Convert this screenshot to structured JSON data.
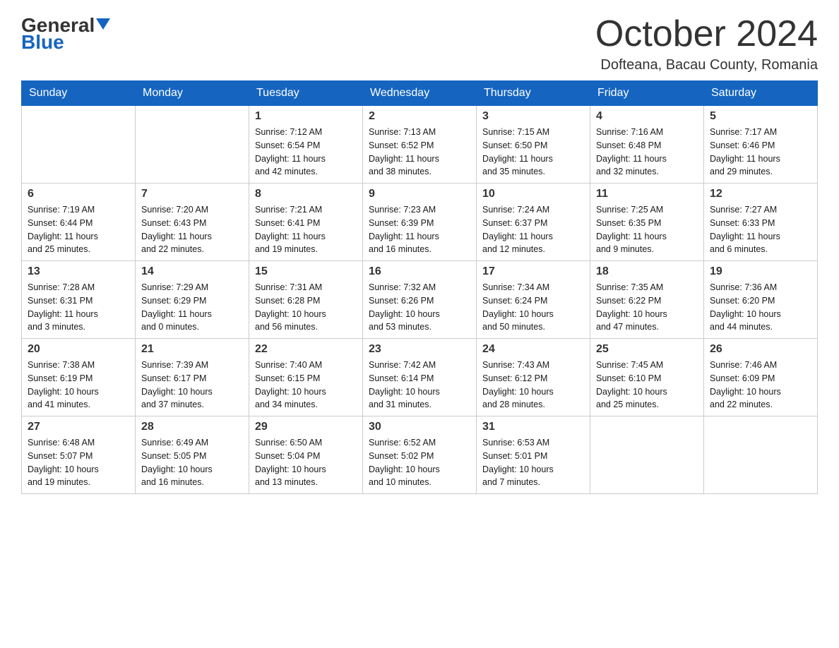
{
  "logo": {
    "general": "General",
    "blue": "Blue"
  },
  "title": {
    "month_year": "October 2024",
    "location": "Dofteana, Bacau County, Romania"
  },
  "days_of_week": [
    "Sunday",
    "Monday",
    "Tuesday",
    "Wednesday",
    "Thursday",
    "Friday",
    "Saturday"
  ],
  "weeks": [
    [
      {
        "day": "",
        "info": ""
      },
      {
        "day": "",
        "info": ""
      },
      {
        "day": "1",
        "info": "Sunrise: 7:12 AM\nSunset: 6:54 PM\nDaylight: 11 hours\nand 42 minutes."
      },
      {
        "day": "2",
        "info": "Sunrise: 7:13 AM\nSunset: 6:52 PM\nDaylight: 11 hours\nand 38 minutes."
      },
      {
        "day": "3",
        "info": "Sunrise: 7:15 AM\nSunset: 6:50 PM\nDaylight: 11 hours\nand 35 minutes."
      },
      {
        "day": "4",
        "info": "Sunrise: 7:16 AM\nSunset: 6:48 PM\nDaylight: 11 hours\nand 32 minutes."
      },
      {
        "day": "5",
        "info": "Sunrise: 7:17 AM\nSunset: 6:46 PM\nDaylight: 11 hours\nand 29 minutes."
      }
    ],
    [
      {
        "day": "6",
        "info": "Sunrise: 7:19 AM\nSunset: 6:44 PM\nDaylight: 11 hours\nand 25 minutes."
      },
      {
        "day": "7",
        "info": "Sunrise: 7:20 AM\nSunset: 6:43 PM\nDaylight: 11 hours\nand 22 minutes."
      },
      {
        "day": "8",
        "info": "Sunrise: 7:21 AM\nSunset: 6:41 PM\nDaylight: 11 hours\nand 19 minutes."
      },
      {
        "day": "9",
        "info": "Sunrise: 7:23 AM\nSunset: 6:39 PM\nDaylight: 11 hours\nand 16 minutes."
      },
      {
        "day": "10",
        "info": "Sunrise: 7:24 AM\nSunset: 6:37 PM\nDaylight: 11 hours\nand 12 minutes."
      },
      {
        "day": "11",
        "info": "Sunrise: 7:25 AM\nSunset: 6:35 PM\nDaylight: 11 hours\nand 9 minutes."
      },
      {
        "day": "12",
        "info": "Sunrise: 7:27 AM\nSunset: 6:33 PM\nDaylight: 11 hours\nand 6 minutes."
      }
    ],
    [
      {
        "day": "13",
        "info": "Sunrise: 7:28 AM\nSunset: 6:31 PM\nDaylight: 11 hours\nand 3 minutes."
      },
      {
        "day": "14",
        "info": "Sunrise: 7:29 AM\nSunset: 6:29 PM\nDaylight: 11 hours\nand 0 minutes."
      },
      {
        "day": "15",
        "info": "Sunrise: 7:31 AM\nSunset: 6:28 PM\nDaylight: 10 hours\nand 56 minutes."
      },
      {
        "day": "16",
        "info": "Sunrise: 7:32 AM\nSunset: 6:26 PM\nDaylight: 10 hours\nand 53 minutes."
      },
      {
        "day": "17",
        "info": "Sunrise: 7:34 AM\nSunset: 6:24 PM\nDaylight: 10 hours\nand 50 minutes."
      },
      {
        "day": "18",
        "info": "Sunrise: 7:35 AM\nSunset: 6:22 PM\nDaylight: 10 hours\nand 47 minutes."
      },
      {
        "day": "19",
        "info": "Sunrise: 7:36 AM\nSunset: 6:20 PM\nDaylight: 10 hours\nand 44 minutes."
      }
    ],
    [
      {
        "day": "20",
        "info": "Sunrise: 7:38 AM\nSunset: 6:19 PM\nDaylight: 10 hours\nand 41 minutes."
      },
      {
        "day": "21",
        "info": "Sunrise: 7:39 AM\nSunset: 6:17 PM\nDaylight: 10 hours\nand 37 minutes."
      },
      {
        "day": "22",
        "info": "Sunrise: 7:40 AM\nSunset: 6:15 PM\nDaylight: 10 hours\nand 34 minutes."
      },
      {
        "day": "23",
        "info": "Sunrise: 7:42 AM\nSunset: 6:14 PM\nDaylight: 10 hours\nand 31 minutes."
      },
      {
        "day": "24",
        "info": "Sunrise: 7:43 AM\nSunset: 6:12 PM\nDaylight: 10 hours\nand 28 minutes."
      },
      {
        "day": "25",
        "info": "Sunrise: 7:45 AM\nSunset: 6:10 PM\nDaylight: 10 hours\nand 25 minutes."
      },
      {
        "day": "26",
        "info": "Sunrise: 7:46 AM\nSunset: 6:09 PM\nDaylight: 10 hours\nand 22 minutes."
      }
    ],
    [
      {
        "day": "27",
        "info": "Sunrise: 6:48 AM\nSunset: 5:07 PM\nDaylight: 10 hours\nand 19 minutes."
      },
      {
        "day": "28",
        "info": "Sunrise: 6:49 AM\nSunset: 5:05 PM\nDaylight: 10 hours\nand 16 minutes."
      },
      {
        "day": "29",
        "info": "Sunrise: 6:50 AM\nSunset: 5:04 PM\nDaylight: 10 hours\nand 13 minutes."
      },
      {
        "day": "30",
        "info": "Sunrise: 6:52 AM\nSunset: 5:02 PM\nDaylight: 10 hours\nand 10 minutes."
      },
      {
        "day": "31",
        "info": "Sunrise: 6:53 AM\nSunset: 5:01 PM\nDaylight: 10 hours\nand 7 minutes."
      },
      {
        "day": "",
        "info": ""
      },
      {
        "day": "",
        "info": ""
      }
    ]
  ]
}
